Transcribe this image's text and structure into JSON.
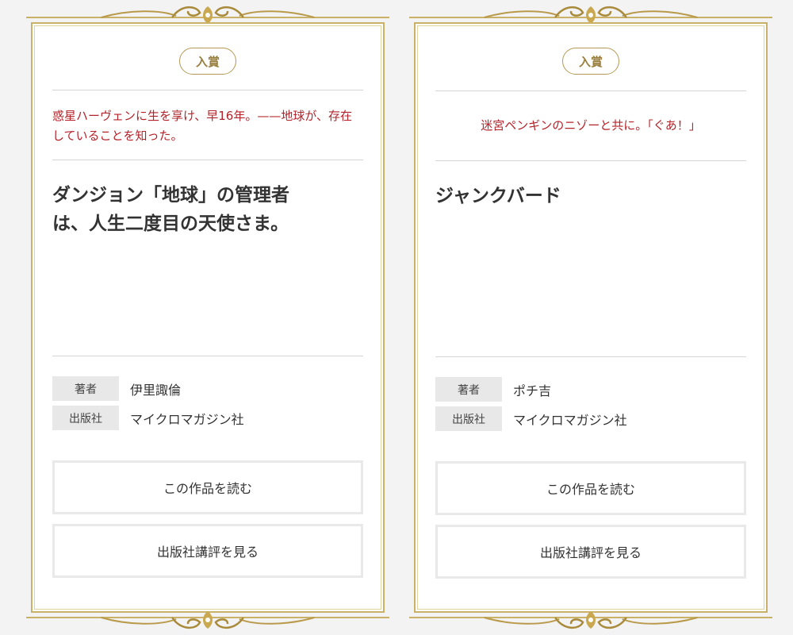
{
  "colors": {
    "page_background": "#f3f3f3",
    "gold_frame": "#c9b268",
    "catchcopy_red": "#b5232a",
    "label_background": "#e8e8e8"
  },
  "cards": [
    {
      "badge": "入賞",
      "catchcopy": "惑星ハーヴェンに生を享け、早16年。——地球が、存在していることを知った。",
      "title_lines": [
        "ダンジョン「地球」の管理者",
        "は、人生二度目の天使さま。"
      ],
      "meta": [
        {
          "label": "著者",
          "value": "伊里諏倫"
        },
        {
          "label": "出版社",
          "value": "マイクロマガジン社"
        }
      ],
      "buttons": {
        "read": "この作品を読む",
        "review": "出版社講評を見る"
      }
    },
    {
      "badge": "入賞",
      "catchcopy": "迷宮ペンギンのニゾーと共に。「ぐあ！」",
      "title_lines": [
        "ジャンクバード"
      ],
      "meta": [
        {
          "label": "著者",
          "value": "ポチ吉"
        },
        {
          "label": "出版社",
          "value": "マイクロマガジン社"
        }
      ],
      "buttons": {
        "read": "この作品を読む",
        "review": "出版社講評を見る"
      }
    }
  ]
}
